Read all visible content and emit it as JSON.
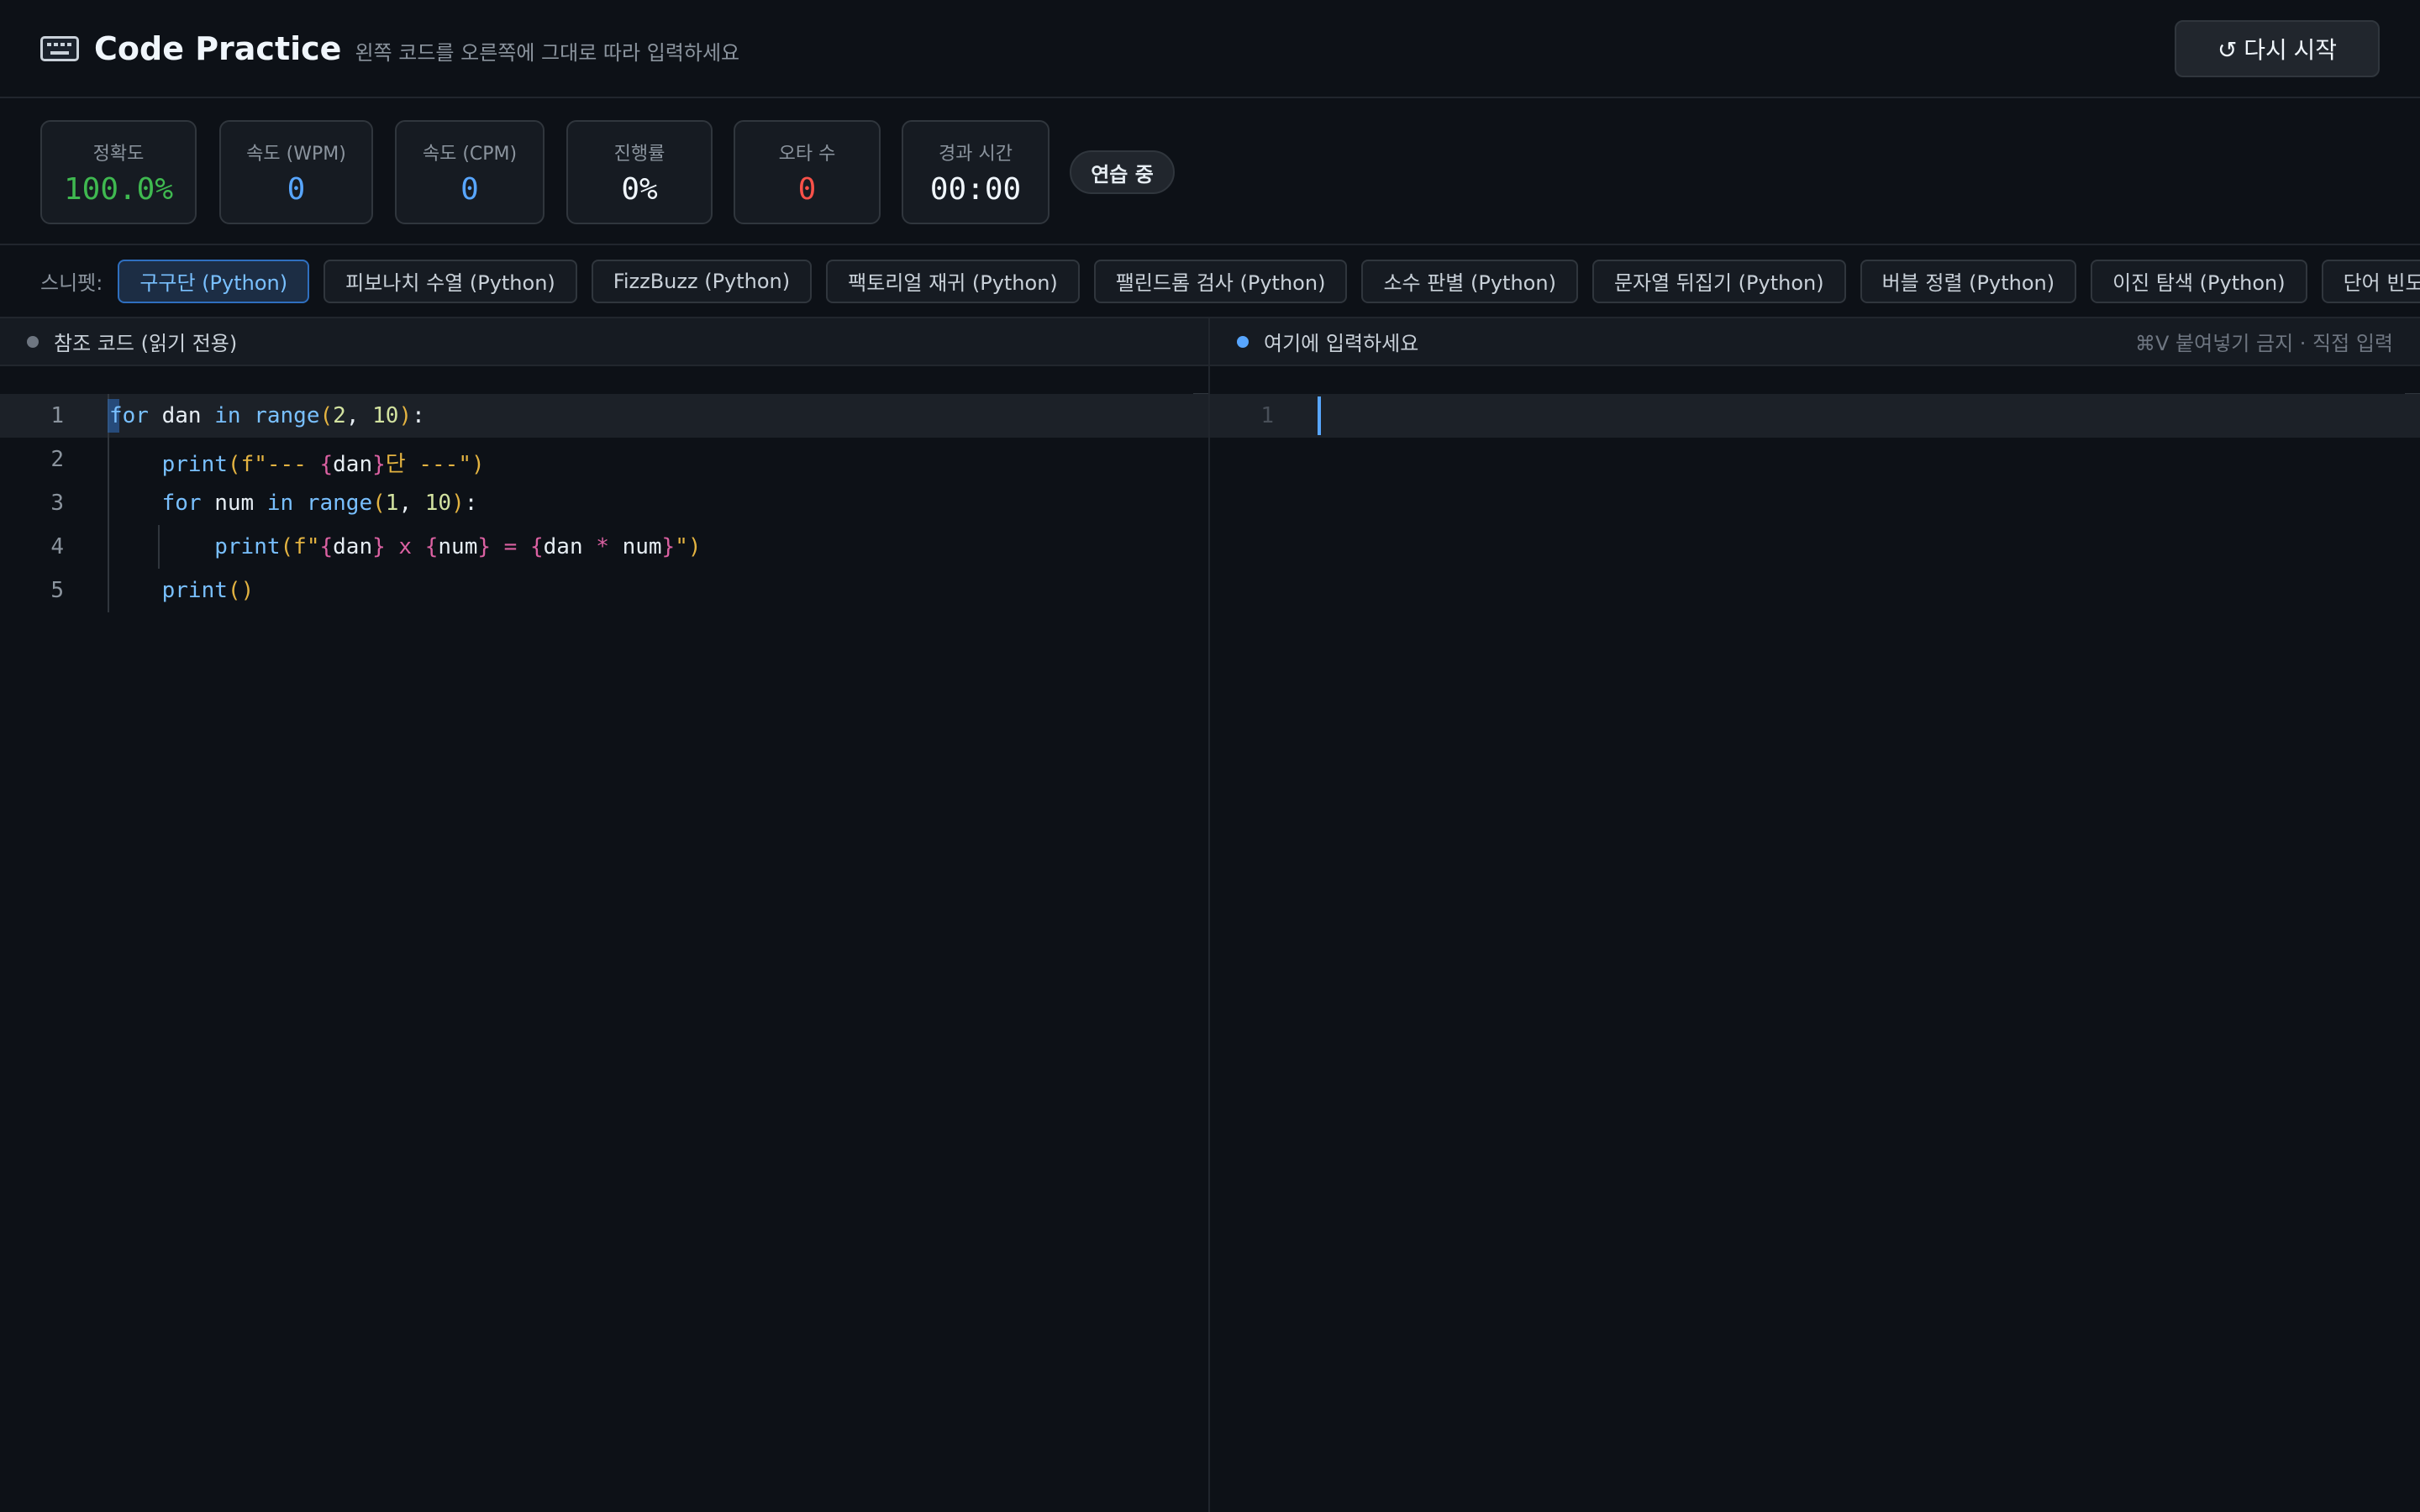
{
  "header": {
    "icon": "keyboard-icon",
    "title": "Code Practice",
    "subtitle": "왼쪽 코드를 오른쪽에 그대로 따라 입력하세요",
    "restart_label": "↺ 다시 시작"
  },
  "stats": {
    "accuracy": {
      "label": "정확도",
      "value": "100.0%"
    },
    "wpm": {
      "label": "속도 (WPM)",
      "value": "0"
    },
    "cpm": {
      "label": "속도 (CPM)",
      "value": "0"
    },
    "progress": {
      "label": "진행률",
      "value": "0%"
    },
    "errors": {
      "label": "오타 수",
      "value": "0"
    },
    "elapsed": {
      "label": "경과 시간",
      "value": "00:00"
    },
    "status_badge": "연습 중"
  },
  "snippets": {
    "label": "스니펫:",
    "items": [
      "구구단 (Python)",
      "피보나치 수열 (Python)",
      "FizzBuzz (Python)",
      "팩토리얼 재귀 (Python)",
      "팰린드롬 검사 (Python)",
      "소수 판별 (Python)",
      "문자열 뒤집기 (Python)",
      "버블 정렬 (Python)",
      "이진 탐색 (Python)",
      "단어 빈도 카운트"
    ],
    "active_index": 0
  },
  "reference_panel": {
    "title": "참조 코드 (읽기 전용)",
    "line_numbers": [
      "1",
      "2",
      "3",
      "4",
      "5"
    ],
    "code": [
      "for dan in range(2, 10):",
      "    print(f\"--- {dan}단 ---\")",
      "    for num in range(1, 10):",
      "        print(f\"{dan} x {num} = {dan * num}\")",
      "    print()"
    ]
  },
  "input_panel": {
    "title": "여기에 입력하세요",
    "hint": "⌘V 붙여넣기 금지 · 직접 입력",
    "line_numbers": [
      "1"
    ]
  },
  "colors": {
    "accuracy": "#3fb950",
    "speed": "#58a6ff",
    "errors": "#f85149",
    "accent": "#58a6ff"
  }
}
